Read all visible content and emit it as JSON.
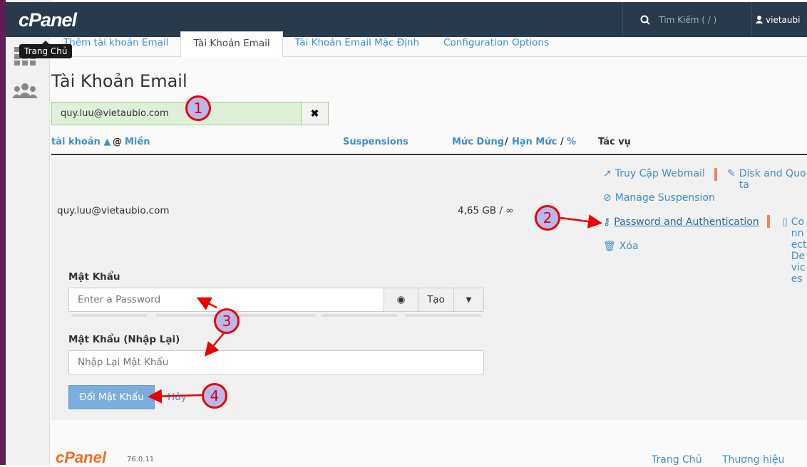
{
  "header": {
    "logo": "cPanel",
    "search_placeholder": "Tìm Kiếm ( / )",
    "username": "vietaubi"
  },
  "sidebar": {
    "tooltip": "Trang Chủ"
  },
  "tabs": [
    {
      "label": "Thêm tài khoản Email"
    },
    {
      "label": "Tài Khoản Email",
      "active": true
    },
    {
      "label": "Tài Khoản Email Mặc Định"
    },
    {
      "label": "Configuration Options"
    }
  ],
  "page_title": "Tài Khoản Email",
  "filter": {
    "value": "quy.luu@vietaubio.com"
  },
  "table": {
    "col_account": "tài khoản ▲",
    "col_at": "@",
    "col_domain": "Miền",
    "col_suspensions": "Suspensions",
    "col_usage": "Mức Dùng",
    "col_slash": "/",
    "col_quota": "Hạn Mức",
    "col_slash2": "/",
    "col_percent": "%",
    "col_actions": "Tác vụ"
  },
  "row": {
    "email": "quy.luu@vietaubio.com",
    "usage": "4,65 GB / ∞",
    "actions": {
      "webmail": "Truy Cập Webmail",
      "disk": "Disk and Quota",
      "suspension": "Manage Suspension",
      "password": "Password and Authentication",
      "connect": "Connect Devices",
      "delete": "Xóa"
    }
  },
  "form": {
    "password_label": "Mật Khẩu",
    "password_placeholder": "Enter a Password",
    "generate": "Tạo",
    "confirm_label": "Mật Khẩu (Nhập Lại)",
    "confirm_placeholder": "Nhập Lại Mật Khẩu",
    "submit": "Đổi Mật Khẩu",
    "cancel": "Hủy",
    "strength": 0
  },
  "annotations": [
    "1",
    "2",
    "3",
    "4"
  ],
  "footer": {
    "logo": "cPanel",
    "version": "76.0.11",
    "links": [
      "Trang Chủ",
      "Thương hiệu"
    ]
  },
  "colors": {
    "header": "#293a4a",
    "link": "#3e8fce",
    "accent": "#f0855a",
    "annotation": "#e00000"
  }
}
